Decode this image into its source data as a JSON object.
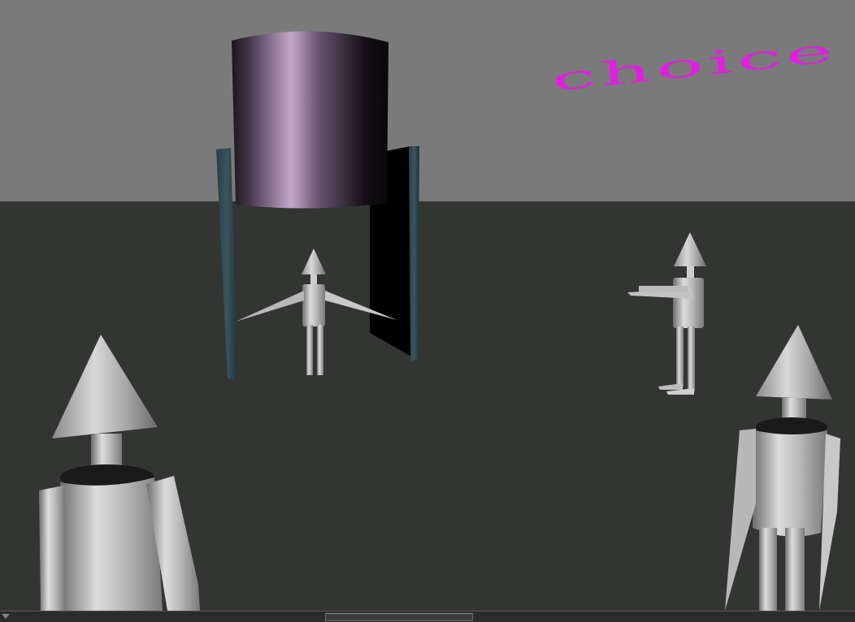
{
  "scene": {
    "floating_text": "choice",
    "floating_text_color": "#e020e0",
    "sky_color": "#7a7a7a",
    "floor_color": "#333533",
    "robot_color": "#c8c8c8",
    "tank_color": "#b494c0"
  }
}
